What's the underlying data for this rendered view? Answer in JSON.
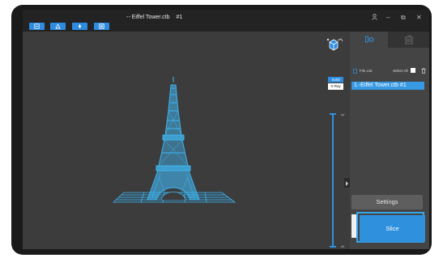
{
  "window": {
    "title_prefix": "--",
    "title": "Eiffel Tower.ctb",
    "title_suffix": "#1",
    "controls": {
      "user": "user-icon",
      "minimize": "–",
      "restore": "⧉",
      "close": "✕"
    }
  },
  "toolbar": {
    "buttons": [
      "open-file-icon",
      "layout-icon",
      "support-icon",
      "hollow-icon"
    ]
  },
  "viewport": {
    "view_modes": {
      "solid": "Solid",
      "xray": "X-Ray"
    },
    "model": "Eiffel Tower"
  },
  "side_panel": {
    "tabs": [
      "print-settings-icon",
      "printer-icon"
    ],
    "file_list_label": "File List",
    "select_all_label": "Select All",
    "files": [
      {
        "label": "1.-Eiffel Tower.ctb #1"
      }
    ],
    "settings_label": "Settings",
    "slice_label": "Slice"
  },
  "colors": {
    "accent": "#2f91dd",
    "model": "#3fb6f2",
    "background": "#3c3c3c"
  }
}
